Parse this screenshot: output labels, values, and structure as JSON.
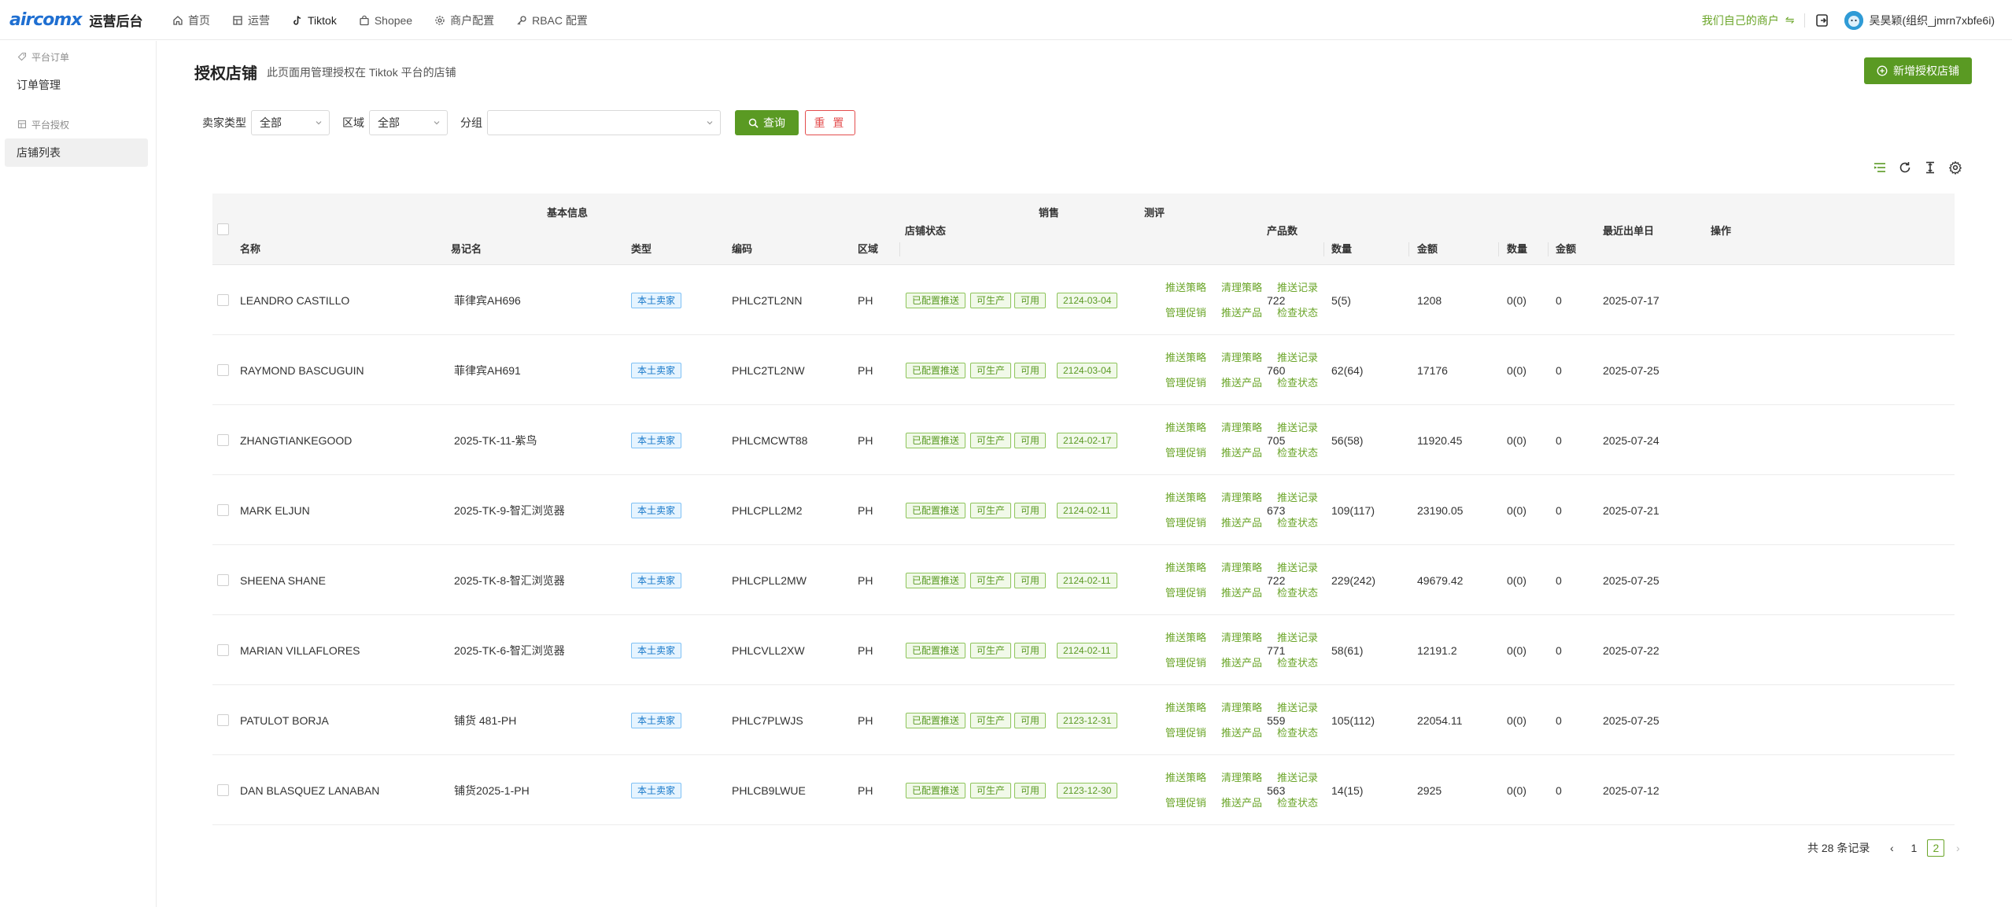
{
  "header": {
    "logo": "aircomx",
    "app_title": "运营后台",
    "nav": [
      {
        "label": "首页",
        "icon": "home-icon"
      },
      {
        "label": "运营",
        "icon": "operations-icon"
      },
      {
        "label": "Tiktok",
        "icon": "tiktok-icon"
      },
      {
        "label": "Shopee",
        "icon": "shopee-bag-icon"
      },
      {
        "label": "商户配置",
        "icon": "gear-icon"
      },
      {
        "label": "RBAC 配置",
        "icon": "key-icon"
      }
    ],
    "merchant_link": "我们自己的商户",
    "swap_symbol": "⇋",
    "user_name": "吴昊颖(组织_jmrn7xbfe6i)"
  },
  "sidebar": {
    "groups": [
      {
        "label": "平台订单",
        "items": [
          {
            "label": "订单管理"
          }
        ]
      },
      {
        "label": "平台授权",
        "items": [
          {
            "label": "店铺列表"
          }
        ]
      }
    ]
  },
  "page": {
    "title": "授权店铺",
    "description": "此页面用管理授权在 Tiktok 平台的店铺",
    "add_button": "新增授权店铺"
  },
  "filters": {
    "seller_type_label": "卖家类型",
    "seller_type_value": "全部",
    "region_label": "区域",
    "region_value": "全部",
    "group_label": "分组",
    "group_value": "",
    "query_button": "查询",
    "reset_button": "重 置"
  },
  "table": {
    "group_headers": {
      "basic": "基本信息",
      "sales": "销售",
      "review": "测评"
    },
    "columns": {
      "name": "名称",
      "alias": "易记名",
      "type": "类型",
      "code": "编码",
      "region": "区域",
      "status": "店铺状态",
      "product_count": "产品数",
      "sales_qty": "数量",
      "sales_amount": "金额",
      "review_qty": "数量",
      "review_amount": "金额",
      "last_order": "最近出单日",
      "actions": "操作"
    },
    "action_labels": [
      "推送策略",
      "清理策略",
      "推送记录",
      "管理促销",
      "推送产品",
      "检查状态"
    ],
    "rows": [
      {
        "name": "LEANDRO CASTILLO",
        "alias": "菲律宾AH696",
        "type": "本土卖家",
        "code": "PHLC2TL2NN",
        "region": "PH",
        "status": [
          "已配置推送",
          "可生产",
          "可用",
          "2124-03-04"
        ],
        "products": "722",
        "sales_qty": "5(5)",
        "sales_amount": "1208",
        "review_qty": "0(0)",
        "review_amount": "0",
        "last_order": "2025-07-17"
      },
      {
        "name": "RAYMOND BASCUGUIN",
        "alias": "菲律宾AH691",
        "type": "本土卖家",
        "code": "PHLC2TL2NW",
        "region": "PH",
        "status": [
          "已配置推送",
          "可生产",
          "可用",
          "2124-03-04"
        ],
        "products": "760",
        "sales_qty": "62(64)",
        "sales_amount": "17176",
        "review_qty": "0(0)",
        "review_amount": "0",
        "last_order": "2025-07-25"
      },
      {
        "name": "ZHANGTIANKEGOOD",
        "alias": "2025-TK-11-紫鸟",
        "type": "本土卖家",
        "code": "PHLCMCWT88",
        "region": "PH",
        "status": [
          "已配置推送",
          "可生产",
          "可用",
          "2124-02-17"
        ],
        "products": "705",
        "sales_qty": "56(58)",
        "sales_amount": "11920.45",
        "review_qty": "0(0)",
        "review_amount": "0",
        "last_order": "2025-07-24"
      },
      {
        "name": "MARK ELJUN",
        "alias": "2025-TK-9-智汇浏览器",
        "type": "本土卖家",
        "code": "PHLCPLL2M2",
        "region": "PH",
        "status": [
          "已配置推送",
          "可生产",
          "可用",
          "2124-02-11"
        ],
        "products": "673",
        "sales_qty": "109(117)",
        "sales_amount": "23190.05",
        "review_qty": "0(0)",
        "review_amount": "0",
        "last_order": "2025-07-21"
      },
      {
        "name": "SHEENA SHANE",
        "alias": "2025-TK-8-智汇浏览器",
        "type": "本土卖家",
        "code": "PHLCPLL2MW",
        "region": "PH",
        "status": [
          "已配置推送",
          "可生产",
          "可用",
          "2124-02-11"
        ],
        "products": "722",
        "sales_qty": "229(242)",
        "sales_amount": "49679.42",
        "review_qty": "0(0)",
        "review_amount": "0",
        "last_order": "2025-07-25"
      },
      {
        "name": "MARIAN VILLAFLORES",
        "alias": "2025-TK-6-智汇浏览器",
        "type": "本土卖家",
        "code": "PHLCVLL2XW",
        "region": "PH",
        "status": [
          "已配置推送",
          "可生产",
          "可用",
          "2124-02-11"
        ],
        "products": "771",
        "sales_qty": "58(61)",
        "sales_amount": "12191.2",
        "review_qty": "0(0)",
        "review_amount": "0",
        "last_order": "2025-07-22"
      },
      {
        "name": "PATULOT BORJA",
        "alias": "铺货 481-PH",
        "type": "本土卖家",
        "code": "PHLC7PLWJS",
        "region": "PH",
        "status": [
          "已配置推送",
          "可生产",
          "可用",
          "2123-12-31"
        ],
        "products": "559",
        "sales_qty": "105(112)",
        "sales_amount": "22054.11",
        "review_qty": "0(0)",
        "review_amount": "0",
        "last_order": "2025-07-25"
      },
      {
        "name": "DAN BLASQUEZ LANABAN",
        "alias": "铺货2025-1-PH",
        "type": "本土卖家",
        "code": "PHLCB9LWUE",
        "region": "PH",
        "status": [
          "已配置推送",
          "可生产",
          "可用",
          "2123-12-30"
        ],
        "products": "563",
        "sales_qty": "14(15)",
        "sales_amount": "2925",
        "review_qty": "0(0)",
        "review_amount": "0",
        "last_order": "2025-07-12"
      }
    ]
  },
  "pagination": {
    "total_text": "共 28 条记录",
    "pages": [
      "1",
      "2"
    ],
    "current_page": "2",
    "prev": "‹",
    "next": "›"
  },
  "colors": {
    "primary_green": "#5a9a23",
    "link_green": "#6aa528",
    "reset_red": "#e34d4d",
    "tag_blue": "#1677c9"
  }
}
